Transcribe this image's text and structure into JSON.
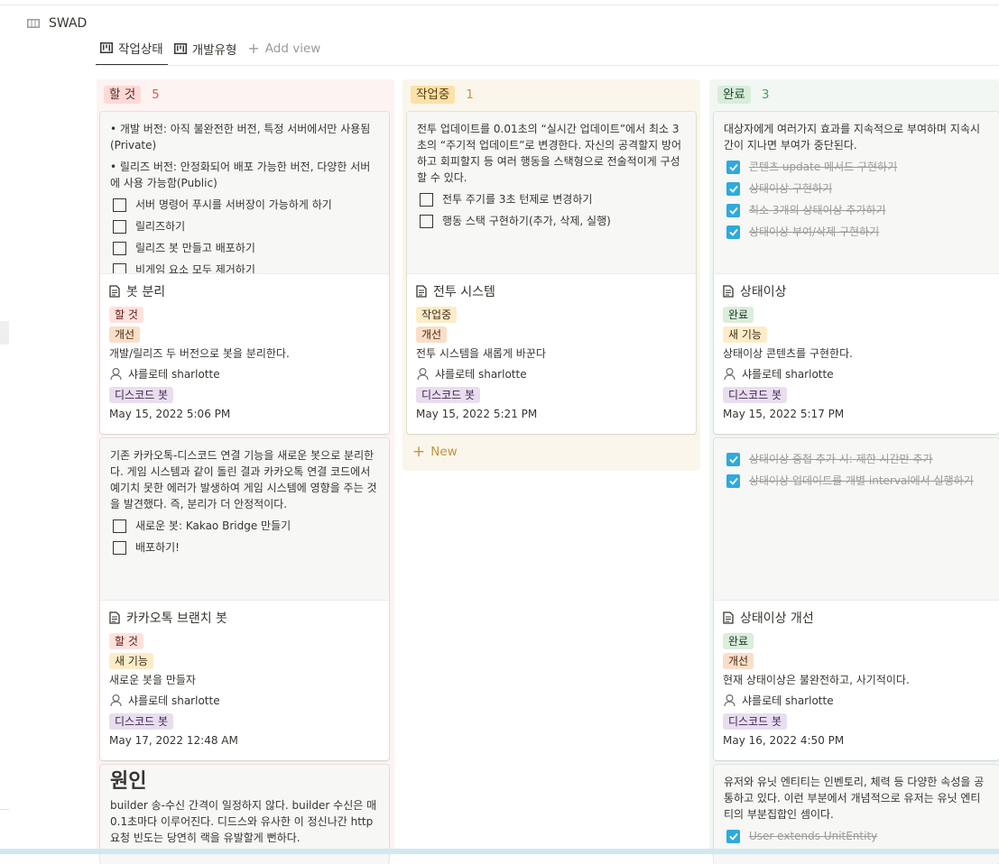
{
  "database": {
    "title": "SWAD",
    "icon": "gallery-icon"
  },
  "views": [
    {
      "label": "작업상태",
      "icon": "board-icon",
      "active": true
    },
    {
      "label": "개발유형",
      "icon": "board-icon",
      "active": false
    },
    {
      "label": "Add view",
      "icon": "plus-icon",
      "active": false
    }
  ],
  "columns": [
    {
      "label": "할 것",
      "count": "5",
      "color": "#ffd9d6"
    },
    {
      "label": "작업중",
      "count": "1",
      "color": "#fbe0a8"
    },
    {
      "label": "완료",
      "count": "3",
      "color": "#d6eedb"
    }
  ],
  "cards": {
    "bot_split": {
      "preview": {
        "bullets": [
          "개발 버전: 아직 불완전한 버전, 특정 서버에서만 사용됨(Private)",
          "릴리즈 버전: 안정화되어 배포 가능한 버전, 다양한 서버에 사용 가능함(Public)"
        ],
        "todos": [
          "서버 명령어 푸시를 서버장이 가능하게 하기",
          "릴리즈하기",
          "릴리즈 봇 만들고 배포하기",
          "비게임 요소 모두 제거하기"
        ]
      },
      "title": "봇 분리",
      "status": "할 것",
      "type": "개선",
      "description": "개발/릴리즈 두 버전으로 봇을 분리한다.",
      "assignee": "샤를로테 sharlotte",
      "category": "디스코드 봇",
      "date": "May 15, 2022 5:06 PM"
    },
    "battle": {
      "preview": {
        "text": "전투 업데이트를 0.01초의 “실시간 업데이트”에서 최소 3초의 “주기적 업데이트”로 변경한다. 자신의 공격할지 방어하고 회피할지 등 여러 행동을 스택형으로 전술적이게 구성할 수 있다.",
        "todos": [
          "전투 주기를 3초 턴제로 변경하기",
          "행동 스택 구현하기(추가, 삭제, 실행)"
        ]
      },
      "title": "전투 시스템",
      "status": "작업중",
      "type": "개선",
      "description": "전투 시스템을 새롭게 바꾼다",
      "assignee": "샤를로테 sharlotte",
      "category": "디스코드 봇",
      "date": "May 15, 2022 5:21 PM"
    },
    "status_effect": {
      "preview": {
        "text": "대상자에게 여러가지 효과를 지속적으로 부여하며 지속시간이 지나면 부여가 중단된다.",
        "todos": [
          "콘텐츠 update 메서드 구현하기",
          "상태이상 구현하기",
          "최소 3개의 상태이상 추가하기",
          "상태이상 부여/삭제 구현하기"
        ]
      },
      "title": "상태이상",
      "status": "완료",
      "type": "새 기능",
      "description": "상태이상 콘텐츠를 구현한다.",
      "assignee": "샤를로테 sharlotte",
      "category": "디스코드 봇",
      "date": "May 15, 2022 5:17 PM"
    },
    "kakao_bot": {
      "preview": {
        "text": "기존 카카오톡-디스코드 연결 기능을 새로운 봇으로 분리한다. 게임 시스템과 같이 돌린 결과 카카오톡 연결 코드에서 예기치 못한 에러가 발생하여 게임 시스템에 영향을 주는 것을 발견했다. 즉, 분리가 더 안정적이다.",
        "todos": [
          "새로운 봇: Kakao Bridge 만들기",
          "배포하기!"
        ]
      },
      "title": "카카오톡 브랜치 봇",
      "status": "할 것",
      "type": "새 기능",
      "description": "새로운 봇을 만들자",
      "assignee": "샤를로테 sharlotte",
      "category": "디스코드 봇",
      "date": "May 17, 2022 12:48 AM"
    },
    "status_effect_improve": {
      "preview": {
        "todos": [
          "상태이상 중첩 추가 시: 제한 시간만 추가",
          "상태이상 업데이트를 개별 interval에서 실행하기"
        ]
      },
      "title": "상태이상 개선",
      "status": "완료",
      "type": "개선",
      "description": "현재 상태이상은 불완전하고, 사기적이다.",
      "assignee": "샤를로테 sharlotte",
      "category": "디스코드 봇",
      "date": "May 16, 2022 4:50 PM"
    },
    "cause": {
      "preview": {
        "heading": "원인",
        "text": "builder 송-수신 간격이 일정하지 않다. builder 수신은 매 0.1초마다 이루어진다. 디드스와 유사한 이 정신나간 http 요청 빈도는 당연히 랙을 유발할게 뻔하다."
      }
    },
    "unit": {
      "preview": {
        "text": "유저와 유닛 엔티티는 인벤토리, 체력 등 다양한 속성을 공통하고 있다. 이런 부분에서 개념적으로 유저는 유닛 엔티티의 부분집합인 셈이다.",
        "todos": [
          "User extends UnitEntity"
        ]
      }
    }
  },
  "new_button": "New"
}
